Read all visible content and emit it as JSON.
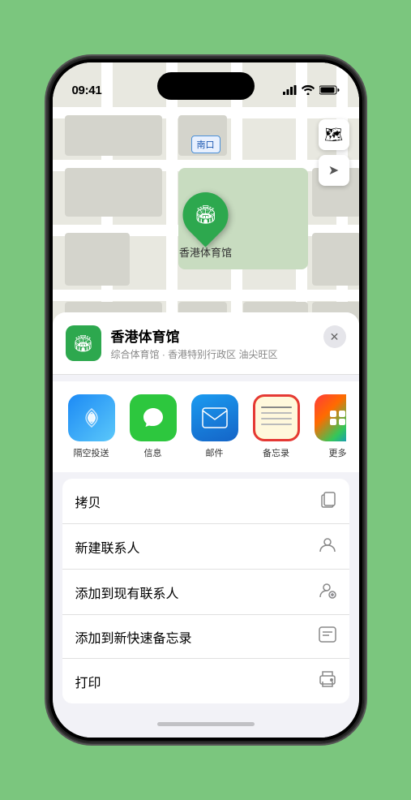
{
  "status": {
    "time": "09:41",
    "location_arrow": true
  },
  "map": {
    "label_south": "南口",
    "location_name": "香港体育馆",
    "controls": [
      "map-type",
      "location"
    ]
  },
  "venue": {
    "name": "香港体育馆",
    "description": "综合体育馆 · 香港特别行政区 油尖旺区",
    "icon": "🏟"
  },
  "share_apps": [
    {
      "id": "airdrop",
      "label": "隔空投送",
      "style": "airdrop"
    },
    {
      "id": "messages",
      "label": "信息",
      "style": "messages"
    },
    {
      "id": "mail",
      "label": "邮件",
      "style": "mail"
    },
    {
      "id": "notes",
      "label": "备忘录",
      "style": "notes",
      "highlighted": true
    }
  ],
  "actions": [
    {
      "id": "copy",
      "label": "拷贝",
      "icon": "📋"
    },
    {
      "id": "new-contact",
      "label": "新建联系人",
      "icon": "👤"
    },
    {
      "id": "add-existing-contact",
      "label": "添加到现有联系人",
      "icon": "👤"
    },
    {
      "id": "add-quick-note",
      "label": "添加到新快速备忘录",
      "icon": "📝"
    },
    {
      "id": "print",
      "label": "打印",
      "icon": "🖨"
    }
  ],
  "close_label": "✕",
  "map_icon_label": "🗺",
  "location_icon_label": "➤"
}
